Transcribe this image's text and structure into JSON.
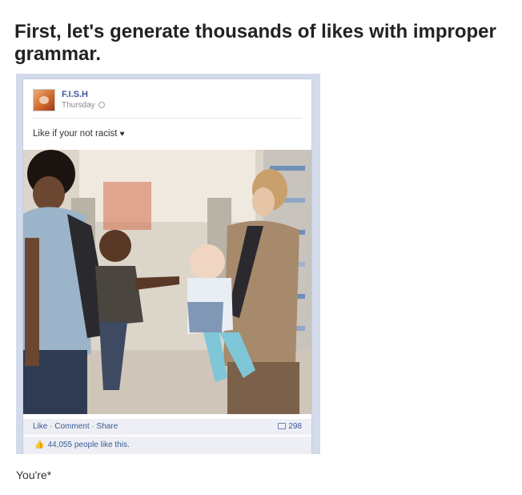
{
  "article": {
    "headline": "First, let's generate thousands of likes with improper grammar.",
    "caption": "You're*"
  },
  "post": {
    "page_name": "F.I.S.H",
    "time": "Thursday",
    "status_text": "Like if your not racist",
    "status_icon": "heart-icon",
    "actions": {
      "like": "Like",
      "comment": "Comment",
      "share": "Share",
      "separator": "·"
    },
    "comment_count": "298",
    "likes_summary": "44,055 people like this."
  },
  "colors": {
    "link_blue": "#3b5998",
    "bar_bg": "#edeff4",
    "frame_bg": "#d3dbeb"
  }
}
